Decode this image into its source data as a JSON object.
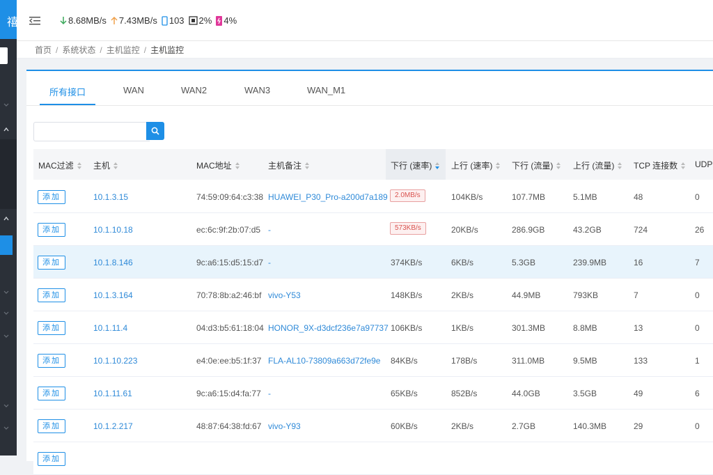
{
  "sidebar": {
    "logo_glyph": "禧"
  },
  "topbar": {
    "download_speed": "8.68MB/s",
    "upload_speed": "7.43MB/s",
    "devices": "103",
    "cpu": "2%",
    "memory": "4%",
    "colors": {
      "down": "#3aa85a",
      "up": "#f0a04a",
      "device": "#1e8fe6",
      "mem": "#e0389a"
    }
  },
  "breadcrumb": [
    "首页",
    "系统状态",
    "主机监控",
    "主机监控"
  ],
  "tabs": [
    {
      "label": "所有接口",
      "active": true
    },
    {
      "label": "WAN",
      "active": false
    },
    {
      "label": "WAN2",
      "active": false
    },
    {
      "label": "WAN3",
      "active": false
    },
    {
      "label": "WAN_M1",
      "active": false
    }
  ],
  "search": {
    "placeholder": ""
  },
  "table": {
    "columns": [
      "MAC过滤",
      "主机",
      "MAC地址",
      "主机备注",
      "下行 (速率)",
      "上行 (速率)",
      "下行 (流量)",
      "上行 (流量)",
      "TCP 连接数",
      "UDP"
    ],
    "add_label": "添加",
    "rows": [
      {
        "host": "10.1.3.15",
        "mac": "74:59:09:64:c3:38",
        "note": "HUAWEI_P30_Pro-a200d7a189",
        "down_rate": "2.0MB/s",
        "up_rate": "104KB/s",
        "down_total": "107.7MB",
        "up_total": "5.1MB",
        "tcp": "48",
        "udp": "0"
      },
      {
        "host": "10.1.10.18",
        "mac": "ec:6c:9f:2b:07:d5",
        "note": "-",
        "down_rate": "573KB/s",
        "up_rate": "20KB/s",
        "down_total": "286.9GB",
        "up_total": "43.2GB",
        "tcp": "724",
        "udp": "26"
      },
      {
        "host": "10.1.8.146",
        "mac": "9c:a6:15:d5:15:d7",
        "note": "-",
        "down_rate": "374KB/s",
        "up_rate": "6KB/s",
        "down_total": "5.3GB",
        "up_total": "239.9MB",
        "tcp": "16",
        "udp": "7"
      },
      {
        "host": "10.1.3.164",
        "mac": "70:78:8b:a2:46:bf",
        "note": "vivo-Y53",
        "down_rate": "148KB/s",
        "up_rate": "2KB/s",
        "down_total": "44.9MB",
        "up_total": "793KB",
        "tcp": "7",
        "udp": "0"
      },
      {
        "host": "10.1.11.4",
        "mac": "04:d3:b5:61:18:04",
        "note": "HONOR_9X-d3dcf236e7a97737",
        "down_rate": "106KB/s",
        "up_rate": "1KB/s",
        "down_total": "301.3MB",
        "up_total": "8.8MB",
        "tcp": "13",
        "udp": "0"
      },
      {
        "host": "10.1.10.223",
        "mac": "e4:0e:ee:b5:1f:37",
        "note": "FLA-AL10-73809a663d72fe9e",
        "down_rate": "84KB/s",
        "up_rate": "178B/s",
        "down_total": "311.0MB",
        "up_total": "9.5MB",
        "tcp": "133",
        "udp": "1"
      },
      {
        "host": "10.1.11.61",
        "mac": "9c:a6:15:d4:fa:77",
        "note": "-",
        "down_rate": "65KB/s",
        "up_rate": "852B/s",
        "down_total": "44.0GB",
        "up_total": "3.5GB",
        "tcp": "49",
        "udp": "6"
      },
      {
        "host": "10.1.2.217",
        "mac": "48:87:64:38:fd:67",
        "note": "vivo-Y93",
        "down_rate": "60KB/s",
        "up_rate": "2KB/s",
        "down_total": "2.7GB",
        "up_total": "140.3MB",
        "tcp": "29",
        "udp": "0"
      }
    ]
  }
}
